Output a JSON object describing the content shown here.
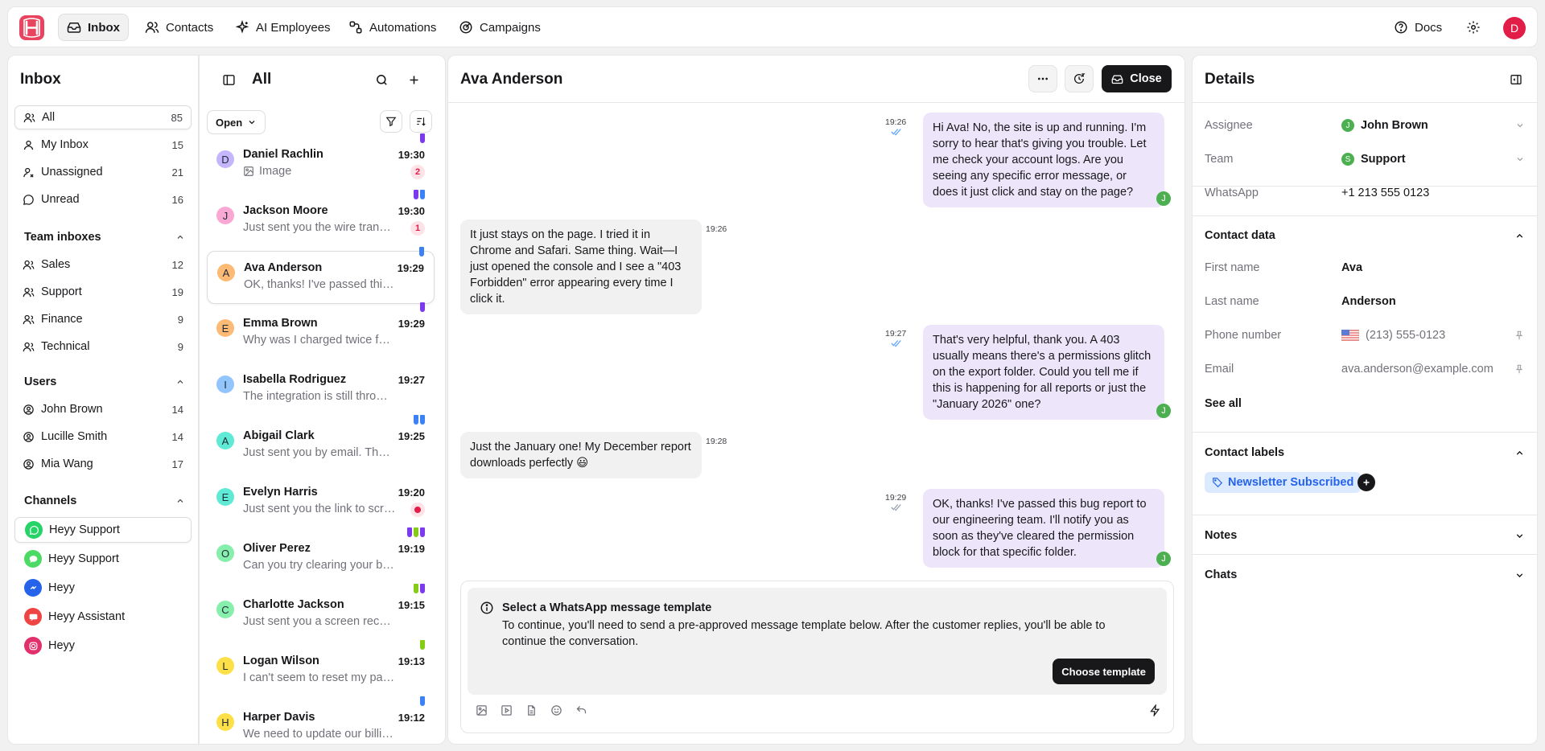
{
  "topnav": {
    "items": [
      {
        "label": "Inbox",
        "icon": "inbox-icon"
      },
      {
        "label": "Contacts",
        "icon": "contacts-icon"
      },
      {
        "label": "AI Employees",
        "icon": "sparkles-icon"
      },
      {
        "label": "Automations",
        "icon": "automations-icon"
      },
      {
        "label": "Campaigns",
        "icon": "campaigns-icon"
      }
    ],
    "docs_label": "Docs",
    "user_initial": "D"
  },
  "sidebar": {
    "title": "Inbox",
    "views": [
      {
        "label": "All",
        "count": "85"
      },
      {
        "label": "My Inbox",
        "count": "15"
      },
      {
        "label": "Unassigned",
        "count": "21"
      },
      {
        "label": "Unread",
        "count": "16"
      }
    ],
    "team_title": "Team inboxes",
    "teams": [
      {
        "label": "Sales",
        "count": "12"
      },
      {
        "label": "Support",
        "count": "19"
      },
      {
        "label": "Finance",
        "count": "9"
      },
      {
        "label": "Technical",
        "count": "9"
      }
    ],
    "users_title": "Users",
    "users": [
      {
        "label": "John Brown",
        "count": "14"
      },
      {
        "label": "Lucille Smith",
        "count": "14"
      },
      {
        "label": "Mia Wang",
        "count": "17"
      }
    ],
    "channels_title": "Channels",
    "channels": [
      {
        "label": "Heyy Support",
        "type": "whatsapp",
        "color": "#25d366"
      },
      {
        "label": "Heyy Support",
        "type": "imessage",
        "color": "#4cd964"
      },
      {
        "label": "Heyy",
        "type": "messenger",
        "color": "#2563eb"
      },
      {
        "label": "Heyy Assistant",
        "type": "chat",
        "color": "#ef4444"
      },
      {
        "label": "Heyy",
        "type": "instagram",
        "color": "#e1306c"
      }
    ]
  },
  "convlist": {
    "title": "All",
    "filter_label": "Open",
    "items": [
      {
        "initial": "D",
        "name": "Daniel Rachlin",
        "preview": "Image",
        "time": "19:30",
        "badge": "2",
        "avatar_color": "#c4b5fd",
        "tags": [
          "#7c3aed"
        ]
      },
      {
        "initial": "J",
        "name": "Jackson Moore",
        "preview": "Just sent you the wire transfer receipt",
        "time": "19:30",
        "badge": "1",
        "avatar_color": "#f9a8d4",
        "tags": [
          "#7c3aed",
          "#3b82f6"
        ]
      },
      {
        "initial": "A",
        "name": "Ava Anderson",
        "preview": "OK, thanks! I've passed this bug report",
        "time": "19:29",
        "badge": "",
        "avatar_color": "#fdba74",
        "tags": [
          "#3b82f6"
        ]
      },
      {
        "initial": "E",
        "name": "Emma Brown",
        "preview": "Why was I charged twice for this month",
        "time": "19:29",
        "badge": "",
        "avatar_color": "#fdba74",
        "tags": [
          "#7c3aed"
        ]
      },
      {
        "initial": "I",
        "name": "Isabella Rodriguez",
        "preview": "The integration is still throwing errors",
        "time": "19:27",
        "badge": "",
        "avatar_color": "#93c5fd",
        "tags": []
      },
      {
        "initial": "A",
        "name": "Abigail Clark",
        "preview": "Just sent you by email. Thanks",
        "time": "19:25",
        "badge": "",
        "avatar_color": "#5eead4",
        "tags": [
          "#3b82f6",
          "#3b82f6"
        ]
      },
      {
        "initial": "E",
        "name": "Evelyn Harris",
        "preview": "Just sent you the link to screenshot",
        "time": "19:20",
        "badge": "",
        "avatar_color": "#5eead4",
        "tags": []
      },
      {
        "initial": "O",
        "name": "Oliver Perez",
        "preview": "Can you try clearing your browser",
        "time": "19:19",
        "badge": "",
        "avatar_color": "#86efac",
        "tags": [
          "#7c3aed",
          "#84cc16",
          "#7c3aed"
        ]
      },
      {
        "initial": "C",
        "name": "Charlotte Jackson",
        "preview": "Just sent you a screen recording",
        "time": "19:15",
        "badge": "",
        "avatar_color": "#86efac",
        "tags": [
          "#84cc16",
          "#7c3aed"
        ]
      },
      {
        "initial": "L",
        "name": "Logan Wilson",
        "preview": "I can't seem to reset my password",
        "time": "19:13",
        "badge": "",
        "avatar_color": "#fde047",
        "tags": [
          "#84cc16"
        ]
      },
      {
        "initial": "H",
        "name": "Harper Davis",
        "preview": "We need to update our billing details",
        "time": "19:12",
        "badge": "",
        "avatar_color": "#fde047",
        "tags": [
          "#3b82f6"
        ]
      }
    ]
  },
  "chat": {
    "contact_name": "Ava Anderson",
    "close_label": "Close",
    "messages": [
      {
        "dir": "out",
        "time": "19:26",
        "text": "Hi Ava! No, the site is up and running. I'm sorry to hear that's giving you trouble. Let me check your account logs. Are you seeing any specific error message, or does it just click and stay on the page?"
      },
      {
        "dir": "in",
        "time": "19:26",
        "text": "It just stays on the page. I tried it in Chrome and Safari. Same thing. Wait—I just opened the console and I see a \"403 Forbidden\" error appearing every time I click it."
      },
      {
        "dir": "out",
        "time": "19:27",
        "text": "That's very helpful, thank you. A 403 usually means there's a permissions glitch on the export folder. Could you tell me if this is happening for all reports or just the \"January 2026\" one?"
      },
      {
        "dir": "in",
        "time": "19:28",
        "text": "Just the January one! My December report downloads perfectly 😃"
      },
      {
        "dir": "out",
        "time": "19:29",
        "text": "OK, thanks! I've passed this bug report to our engineering team. I'll notify you as soon as they've cleared the permission block for that specific folder."
      }
    ],
    "agent_initial": "J",
    "template_title": "Select a WhatsApp message template",
    "template_text": "To continue, you'll need to send a pre-approved message template below. After the customer replies, you'll be able to continue the conversation.",
    "choose_template_label": "Choose template"
  },
  "details": {
    "title": "Details",
    "assignee_label": "Assignee",
    "assignee_initial": "J",
    "assignee": "John Brown",
    "team_label": "Team",
    "team_initial": "S",
    "team": "Support",
    "whatsapp_label": "WhatsApp",
    "whatsapp": "+1 213 555 0123",
    "contact_data_title": "Contact data",
    "first_name_label": "First name",
    "first_name": "Ava",
    "last_name_label": "Last name",
    "last_name": "Anderson",
    "phone_label": "Phone number",
    "phone": "(213) 555-0123",
    "email_label": "Email",
    "email": "ava.anderson@example.com",
    "see_all_label": "See all",
    "labels_title": "Contact labels",
    "label_chip": "Newsletter Subscribed",
    "notes_title": "Notes",
    "chats_title": "Chats"
  }
}
